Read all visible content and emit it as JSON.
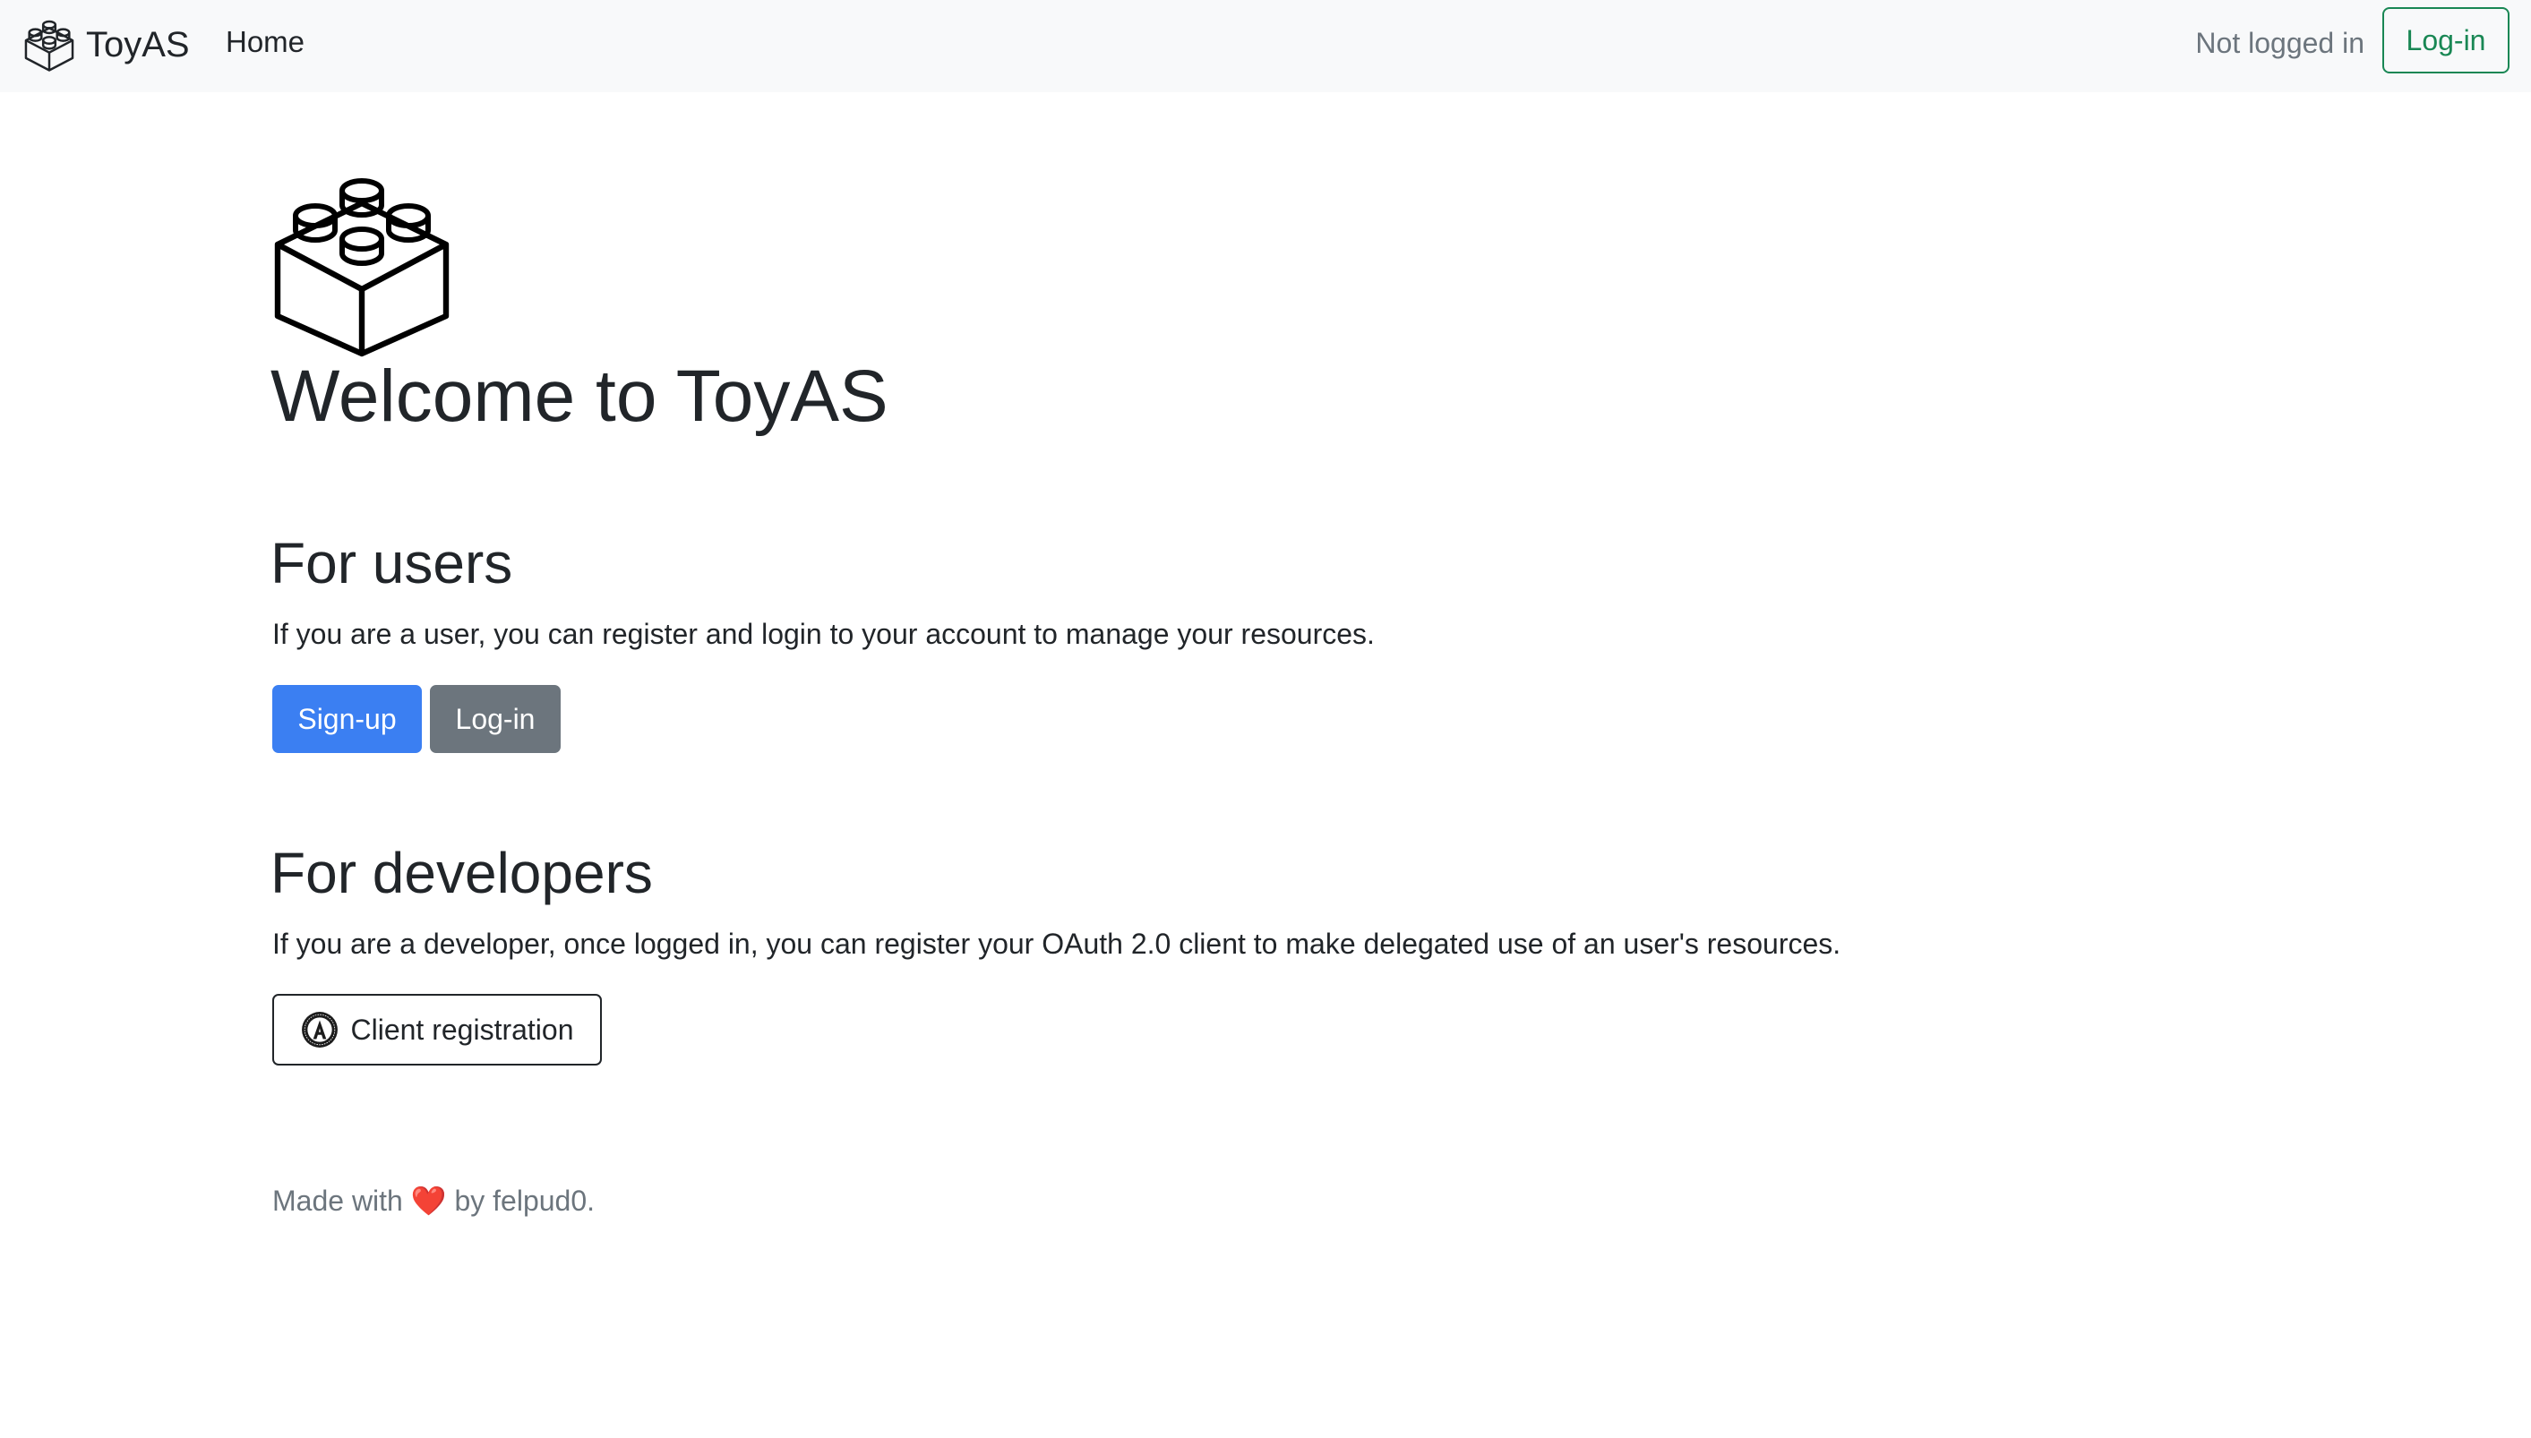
{
  "navbar": {
    "brand": {
      "name": "ToyAS",
      "icon": "lego-brick-icon"
    },
    "home_label": "Home",
    "status": "Not logged in",
    "login_label": "Log-in",
    "login_color": "#198754"
  },
  "hero": {
    "logo_icon": "lego-brick-icon",
    "title": "Welcome to ToyAS"
  },
  "users": {
    "heading": "For users",
    "description": "If you are a user, you can register and login to your account to manage your resources.",
    "signup_label": "Sign-up",
    "login_label": "Log-in",
    "signup_color": "#3b7ff2",
    "login_color": "#6c757d"
  },
  "developers": {
    "heading": "For developers",
    "description": "If you are a developer, once logged in, you can register your OAuth 2.0 client to make delegated use of an user's resources.",
    "client_registration_label": "Client registration",
    "client_registration_icon": "oauth-logo-icon"
  },
  "footer": {
    "prefix": "Made with",
    "heart": "❤️",
    "suffix": "by felpud0.",
    "heart_color": "#e0192b"
  }
}
